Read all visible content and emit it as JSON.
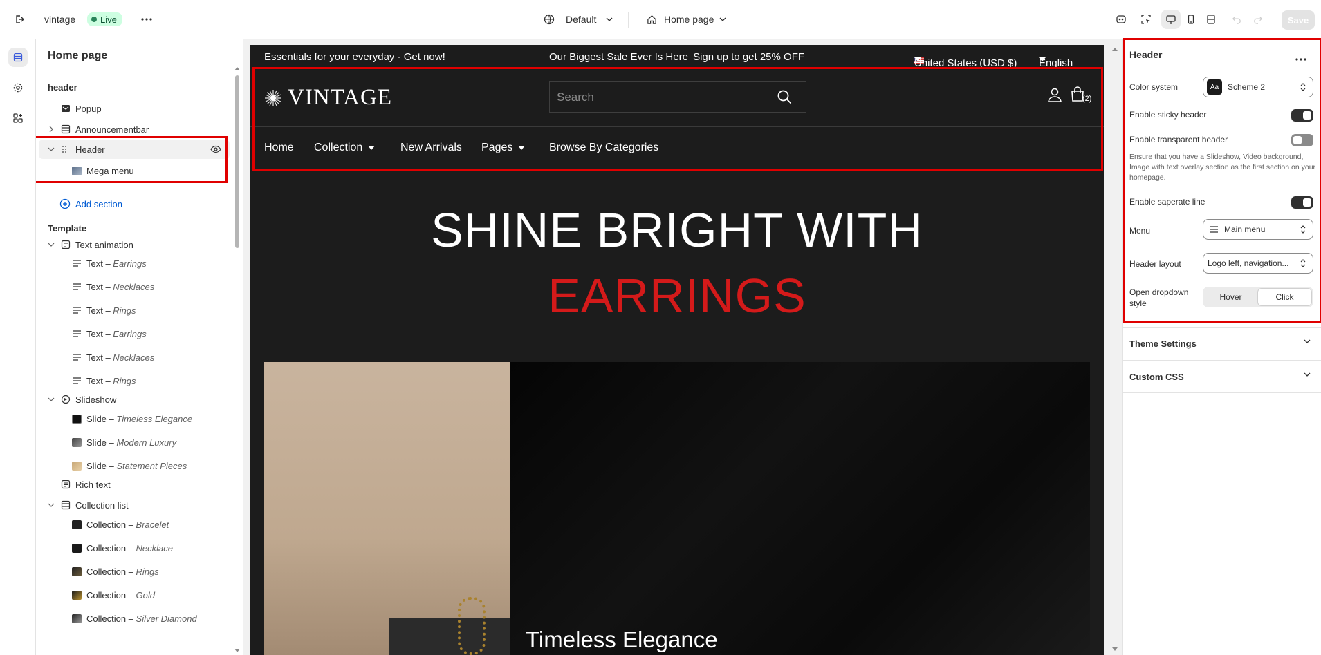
{
  "topbar": {
    "store_name": "vintage",
    "status": "Live",
    "theme": "Default",
    "page": "Home page",
    "save_label": "Save"
  },
  "left_panel": {
    "title": "Home page",
    "header_group": "header",
    "header_items": [
      {
        "label": "Popup"
      },
      {
        "label": "Announcementbar"
      },
      {
        "label": "Header"
      },
      {
        "label": "Mega menu"
      }
    ],
    "add_section": "Add section",
    "template_group": "Template",
    "template_items": [
      {
        "label": "Text animation"
      },
      {
        "prefix": "Text – ",
        "name": "Earrings"
      },
      {
        "prefix": "Text – ",
        "name": "Necklaces"
      },
      {
        "prefix": "Text – ",
        "name": "Rings"
      },
      {
        "prefix": "Text – ",
        "name": "Earrings"
      },
      {
        "prefix": "Text – ",
        "name": "Necklaces"
      },
      {
        "prefix": "Text – ",
        "name": "Rings"
      },
      {
        "label": "Slideshow"
      },
      {
        "prefix": "Slide – ",
        "name": "Timeless Elegance"
      },
      {
        "prefix": "Slide – ",
        "name": "Modern Luxury"
      },
      {
        "prefix": "Slide – ",
        "name": "Statement Pieces"
      },
      {
        "label": "Rich text"
      },
      {
        "label": "Collection list"
      },
      {
        "prefix": "Collection – ",
        "name": "Bracelet"
      },
      {
        "prefix": "Collection – ",
        "name": "Necklace"
      },
      {
        "prefix": "Collection – ",
        "name": "Rings"
      },
      {
        "prefix": "Collection – ",
        "name": "Gold"
      },
      {
        "prefix": "Collection – ",
        "name": "Silver Diamond"
      }
    ]
  },
  "store": {
    "announcement_left": "Essentials for your everyday - Get now!",
    "announcement_center": "Our Biggest Sale Ever Is Here",
    "announcement_link": "Sign up to get 25% OFF",
    "currency": "United States (USD $)",
    "language": "English",
    "logo": "VINTAGE",
    "search_placeholder": "Search",
    "cart_count": "(2)",
    "nav": [
      "Home",
      "Collection",
      "New Arrivals",
      "Pages",
      "Browse By Categories"
    ],
    "hero_line1": "SHINE BRIGHT WITH",
    "hero_line2": "EARRINGS",
    "slide_caption": "Timeless Elegance"
  },
  "right_panel": {
    "title": "Header",
    "color_system_label": "Color system",
    "color_system_value": "Scheme 2",
    "color_system_swatch": "Aa",
    "sticky_label": "Enable sticky header",
    "sticky_on": true,
    "transparent_label": "Enable transparent header",
    "transparent_on": false,
    "transparent_hint": "Ensure that you have a Slideshow, Video background, Image with text overlay section as the first section on your homepage.",
    "separate_label": "Enable saperate line",
    "separate_on": true,
    "menu_label": "Menu",
    "menu_value": "Main menu",
    "layout_label": "Header layout",
    "layout_value": "Logo left, navigation...",
    "dropdown_label": "Open dropdown style",
    "dropdown_options": [
      "Hover",
      "Click"
    ],
    "dropdown_selected": "Click",
    "theme_settings": "Theme Settings",
    "custom_css": "Custom CSS"
  },
  "colors": {
    "highlight": "#e00000",
    "hero_accent": "#d41a1a",
    "live_badge_bg": "#cdfee1"
  }
}
